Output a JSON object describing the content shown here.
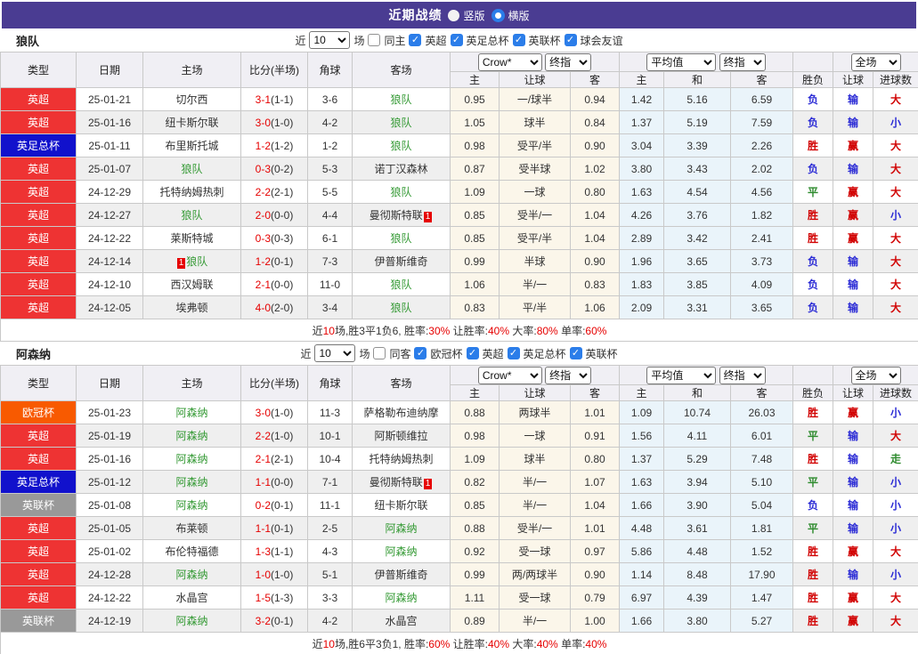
{
  "title_bar": {
    "title": "近期战绩",
    "radios": [
      {
        "label": "竖版",
        "checked": false
      },
      {
        "label": "横版",
        "checked": true
      }
    ]
  },
  "colors": {
    "accent_purple": "#4a3c92",
    "checkbox_blue": "#2b7de9",
    "league": {
      "英超": "#ee3333",
      "英足总杯": "#1111cc",
      "欧冠杯": "#f85a00",
      "英联杯": "#999999"
    },
    "result_red": "#d10000",
    "result_blue": "#2b2bd5",
    "result_green": "#2e8b2e",
    "team_highlight": "#339933",
    "score_red": "#e60000",
    "odds_col_bg": "#fbf6ea",
    "avg_col_bg": "#eaf4fa"
  },
  "table_header": {
    "left_cols": [
      "类型",
      "日期",
      "主场",
      "比分(半场)",
      "角球",
      "客场"
    ],
    "dropdowns": {
      "odds_source": "Crow*",
      "odds_stage": "终指",
      "avg_source": "平均值",
      "avg_stage": "终指",
      "result_scope": "全场"
    },
    "sub_cols": [
      "主",
      "让球",
      "客",
      "主",
      "和",
      "客",
      "胜负",
      "让球",
      "进球数"
    ]
  },
  "sections": [
    {
      "team": "狼队",
      "filter": {
        "near_label": "近",
        "count": "10",
        "games_label": "场",
        "same_label": "同主",
        "same_checked": false,
        "leagues": [
          "英超",
          "英足总杯",
          "英联杯",
          "球会友谊"
        ]
      },
      "rows": [
        {
          "league": "英超",
          "date": "25-01-21",
          "home": "切尔西",
          "home_hl": false,
          "home_badge": "",
          "home_badge_pos": "",
          "score": "3-1",
          "half": "(1-1)",
          "corners": "3-6",
          "away": "狼队",
          "away_hl": true,
          "away_badge": "",
          "away_badge_pos": "",
          "odds": [
            "0.95",
            "一/球半",
            "0.94"
          ],
          "avg": [
            "1.42",
            "5.16",
            "6.59"
          ],
          "results": [
            "负",
            "输",
            "大"
          ]
        },
        {
          "league": "英超",
          "date": "25-01-16",
          "home": "纽卡斯尔联",
          "home_hl": false,
          "home_badge": "",
          "home_badge_pos": "",
          "score": "3-0",
          "half": "(1-0)",
          "corners": "4-2",
          "away": "狼队",
          "away_hl": true,
          "away_badge": "",
          "away_badge_pos": "",
          "odds": [
            "1.05",
            "球半",
            "0.84"
          ],
          "avg": [
            "1.37",
            "5.19",
            "7.59"
          ],
          "results": [
            "负",
            "输",
            "小"
          ]
        },
        {
          "league": "英足总杯",
          "date": "25-01-11",
          "home": "布里斯托城",
          "home_hl": false,
          "home_badge": "",
          "home_badge_pos": "",
          "score": "1-2",
          "half": "(1-2)",
          "corners": "1-2",
          "away": "狼队",
          "away_hl": true,
          "away_badge": "",
          "away_badge_pos": "",
          "odds": [
            "0.98",
            "受平/半",
            "0.90"
          ],
          "avg": [
            "3.04",
            "3.39",
            "2.26"
          ],
          "results": [
            "胜",
            "赢",
            "大"
          ]
        },
        {
          "league": "英超",
          "date": "25-01-07",
          "home": "狼队",
          "home_hl": true,
          "home_badge": "",
          "home_badge_pos": "",
          "score": "0-3",
          "half": "(0-2)",
          "corners": "5-3",
          "away": "诺丁汉森林",
          "away_hl": false,
          "away_badge": "",
          "away_badge_pos": "",
          "odds": [
            "0.87",
            "受半球",
            "1.02"
          ],
          "avg": [
            "3.80",
            "3.43",
            "2.02"
          ],
          "results": [
            "负",
            "输",
            "大"
          ]
        },
        {
          "league": "英超",
          "date": "24-12-29",
          "home": "托特纳姆热刺",
          "home_hl": false,
          "home_badge": "",
          "home_badge_pos": "",
          "score": "2-2",
          "half": "(2-1)",
          "corners": "5-5",
          "away": "狼队",
          "away_hl": true,
          "away_badge": "",
          "away_badge_pos": "",
          "odds": [
            "1.09",
            "一球",
            "0.80"
          ],
          "avg": [
            "1.63",
            "4.54",
            "4.56"
          ],
          "results": [
            "平",
            "赢",
            "大"
          ]
        },
        {
          "league": "英超",
          "date": "24-12-27",
          "home": "狼队",
          "home_hl": true,
          "home_badge": "",
          "home_badge_pos": "",
          "score": "2-0",
          "half": "(0-0)",
          "corners": "4-4",
          "away": "曼彻斯特联",
          "away_hl": false,
          "away_badge": "1",
          "away_badge_pos": "after",
          "odds": [
            "0.85",
            "受半/一",
            "1.04"
          ],
          "avg": [
            "4.26",
            "3.76",
            "1.82"
          ],
          "results": [
            "胜",
            "赢",
            "小"
          ]
        },
        {
          "league": "英超",
          "date": "24-12-22",
          "home": "莱斯特城",
          "home_hl": false,
          "home_badge": "",
          "home_badge_pos": "",
          "score": "0-3",
          "half": "(0-3)",
          "corners": "6-1",
          "away": "狼队",
          "away_hl": true,
          "away_badge": "",
          "away_badge_pos": "",
          "odds": [
            "0.85",
            "受平/半",
            "1.04"
          ],
          "avg": [
            "2.89",
            "3.42",
            "2.41"
          ],
          "results": [
            "胜",
            "赢",
            "大"
          ]
        },
        {
          "league": "英超",
          "date": "24-12-14",
          "home": "狼队",
          "home_hl": true,
          "home_badge": "1",
          "home_badge_pos": "before",
          "score": "1-2",
          "half": "(0-1)",
          "corners": "7-3",
          "away": "伊普斯维奇",
          "away_hl": false,
          "away_badge": "",
          "away_badge_pos": "",
          "odds": [
            "0.99",
            "半球",
            "0.90"
          ],
          "avg": [
            "1.96",
            "3.65",
            "3.73"
          ],
          "results": [
            "负",
            "输",
            "大"
          ]
        },
        {
          "league": "英超",
          "date": "24-12-10",
          "home": "西汉姆联",
          "home_hl": false,
          "home_badge": "",
          "home_badge_pos": "",
          "score": "2-1",
          "half": "(0-0)",
          "corners": "11-0",
          "away": "狼队",
          "away_hl": true,
          "away_badge": "",
          "away_badge_pos": "",
          "odds": [
            "1.06",
            "半/一",
            "0.83"
          ],
          "avg": [
            "1.83",
            "3.85",
            "4.09"
          ],
          "results": [
            "负",
            "输",
            "大"
          ]
        },
        {
          "league": "英超",
          "date": "24-12-05",
          "home": "埃弗顿",
          "home_hl": false,
          "home_badge": "",
          "home_badge_pos": "",
          "score": "4-0",
          "half": "(2-0)",
          "corners": "3-4",
          "away": "狼队",
          "away_hl": true,
          "away_badge": "",
          "away_badge_pos": "",
          "odds": [
            "0.83",
            "平/半",
            "1.06"
          ],
          "avg": [
            "2.09",
            "3.31",
            "3.65"
          ],
          "results": [
            "负",
            "输",
            "大"
          ]
        }
      ],
      "summary": [
        {
          "text": "近",
          "red": false
        },
        {
          "text": "10",
          "red": true
        },
        {
          "text": "场,胜3平1负6, 胜率:",
          "red": false
        },
        {
          "text": "30%",
          "red": true
        },
        {
          "text": " 让胜率:",
          "red": false
        },
        {
          "text": "40%",
          "red": true
        },
        {
          "text": " 大率:",
          "red": false
        },
        {
          "text": "80%",
          "red": true
        },
        {
          "text": " 单率:",
          "red": false
        },
        {
          "text": "60%",
          "red": true
        }
      ]
    },
    {
      "team": "阿森纳",
      "filter": {
        "near_label": "近",
        "count": "10",
        "games_label": "场",
        "same_label": "同客",
        "same_checked": false,
        "leagues": [
          "欧冠杯",
          "英超",
          "英足总杯",
          "英联杯"
        ]
      },
      "rows": [
        {
          "league": "欧冠杯",
          "date": "25-01-23",
          "home": "阿森纳",
          "home_hl": true,
          "home_badge": "",
          "home_badge_pos": "",
          "score": "3-0",
          "half": "(1-0)",
          "corners": "11-3",
          "away": "萨格勒布迪纳摩",
          "away_hl": false,
          "away_badge": "",
          "away_badge_pos": "",
          "odds": [
            "0.88",
            "两球半",
            "1.01"
          ],
          "avg": [
            "1.09",
            "10.74",
            "26.03"
          ],
          "results": [
            "胜",
            "赢",
            "小"
          ]
        },
        {
          "league": "英超",
          "date": "25-01-19",
          "home": "阿森纳",
          "home_hl": true,
          "home_badge": "",
          "home_badge_pos": "",
          "score": "2-2",
          "half": "(1-0)",
          "corners": "10-1",
          "away": "阿斯顿维拉",
          "away_hl": false,
          "away_badge": "",
          "away_badge_pos": "",
          "odds": [
            "0.98",
            "一球",
            "0.91"
          ],
          "avg": [
            "1.56",
            "4.11",
            "6.01"
          ],
          "results": [
            "平",
            "输",
            "大"
          ]
        },
        {
          "league": "英超",
          "date": "25-01-16",
          "home": "阿森纳",
          "home_hl": true,
          "home_badge": "",
          "home_badge_pos": "",
          "score": "2-1",
          "half": "(2-1)",
          "corners": "10-4",
          "away": "托特纳姆热刺",
          "away_hl": false,
          "away_badge": "",
          "away_badge_pos": "",
          "odds": [
            "1.09",
            "球半",
            "0.80"
          ],
          "avg": [
            "1.37",
            "5.29",
            "7.48"
          ],
          "results": [
            "胜",
            "输",
            "走"
          ]
        },
        {
          "league": "英足总杯",
          "date": "25-01-12",
          "home": "阿森纳",
          "home_hl": true,
          "home_badge": "",
          "home_badge_pos": "",
          "score": "1-1",
          "half": "(0-0)",
          "corners": "7-1",
          "away": "曼彻斯特联",
          "away_hl": false,
          "away_badge": "1",
          "away_badge_pos": "after",
          "odds": [
            "0.82",
            "半/一",
            "1.07"
          ],
          "avg": [
            "1.63",
            "3.94",
            "5.10"
          ],
          "results": [
            "平",
            "输",
            "小"
          ]
        },
        {
          "league": "英联杯",
          "date": "25-01-08",
          "home": "阿森纳",
          "home_hl": true,
          "home_badge": "",
          "home_badge_pos": "",
          "score": "0-2",
          "half": "(0-1)",
          "corners": "11-1",
          "away": "纽卡斯尔联",
          "away_hl": false,
          "away_badge": "",
          "away_badge_pos": "",
          "odds": [
            "0.85",
            "半/一",
            "1.04"
          ],
          "avg": [
            "1.66",
            "3.90",
            "5.04"
          ],
          "results": [
            "负",
            "输",
            "小"
          ]
        },
        {
          "league": "英超",
          "date": "25-01-05",
          "home": "布莱顿",
          "home_hl": false,
          "home_badge": "",
          "home_badge_pos": "",
          "score": "1-1",
          "half": "(0-1)",
          "corners": "2-5",
          "away": "阿森纳",
          "away_hl": true,
          "away_badge": "",
          "away_badge_pos": "",
          "odds": [
            "0.88",
            "受半/一",
            "1.01"
          ],
          "avg": [
            "4.48",
            "3.61",
            "1.81"
          ],
          "results": [
            "平",
            "输",
            "小"
          ]
        },
        {
          "league": "英超",
          "date": "25-01-02",
          "home": "布伦特福德",
          "home_hl": false,
          "home_badge": "",
          "home_badge_pos": "",
          "score": "1-3",
          "half": "(1-1)",
          "corners": "4-3",
          "away": "阿森纳",
          "away_hl": true,
          "away_badge": "",
          "away_badge_pos": "",
          "odds": [
            "0.92",
            "受一球",
            "0.97"
          ],
          "avg": [
            "5.86",
            "4.48",
            "1.52"
          ],
          "results": [
            "胜",
            "赢",
            "大"
          ]
        },
        {
          "league": "英超",
          "date": "24-12-28",
          "home": "阿森纳",
          "home_hl": true,
          "home_badge": "",
          "home_badge_pos": "",
          "score": "1-0",
          "half": "(1-0)",
          "corners": "5-1",
          "away": "伊普斯维奇",
          "away_hl": false,
          "away_badge": "",
          "away_badge_pos": "",
          "odds": [
            "0.99",
            "两/两球半",
            "0.90"
          ],
          "avg": [
            "1.14",
            "8.48",
            "17.90"
          ],
          "results": [
            "胜",
            "输",
            "小"
          ]
        },
        {
          "league": "英超",
          "date": "24-12-22",
          "home": "水晶宫",
          "home_hl": false,
          "home_badge": "",
          "home_badge_pos": "",
          "score": "1-5",
          "half": "(1-3)",
          "corners": "3-3",
          "away": "阿森纳",
          "away_hl": true,
          "away_badge": "",
          "away_badge_pos": "",
          "odds": [
            "1.11",
            "受一球",
            "0.79"
          ],
          "avg": [
            "6.97",
            "4.39",
            "1.47"
          ],
          "results": [
            "胜",
            "赢",
            "大"
          ]
        },
        {
          "league": "英联杯",
          "date": "24-12-19",
          "home": "阿森纳",
          "home_hl": true,
          "home_badge": "",
          "home_badge_pos": "",
          "score": "3-2",
          "half": "(0-1)",
          "corners": "4-2",
          "away": "水晶宫",
          "away_hl": false,
          "away_badge": "",
          "away_badge_pos": "",
          "odds": [
            "0.89",
            "半/一",
            "1.00"
          ],
          "avg": [
            "1.66",
            "3.80",
            "5.27"
          ],
          "results": [
            "胜",
            "赢",
            "大"
          ]
        }
      ],
      "summary": [
        {
          "text": "近",
          "red": false
        },
        {
          "text": "10",
          "red": true
        },
        {
          "text": "场,胜6平3负1, 胜率:",
          "red": false
        },
        {
          "text": "60%",
          "red": true
        },
        {
          "text": " 让胜率:",
          "red": false
        },
        {
          "text": "40%",
          "red": true
        },
        {
          "text": " 大率:",
          "red": false
        },
        {
          "text": "40%",
          "red": true
        },
        {
          "text": " 单率:",
          "red": false
        },
        {
          "text": "40%",
          "red": true
        }
      ]
    }
  ]
}
